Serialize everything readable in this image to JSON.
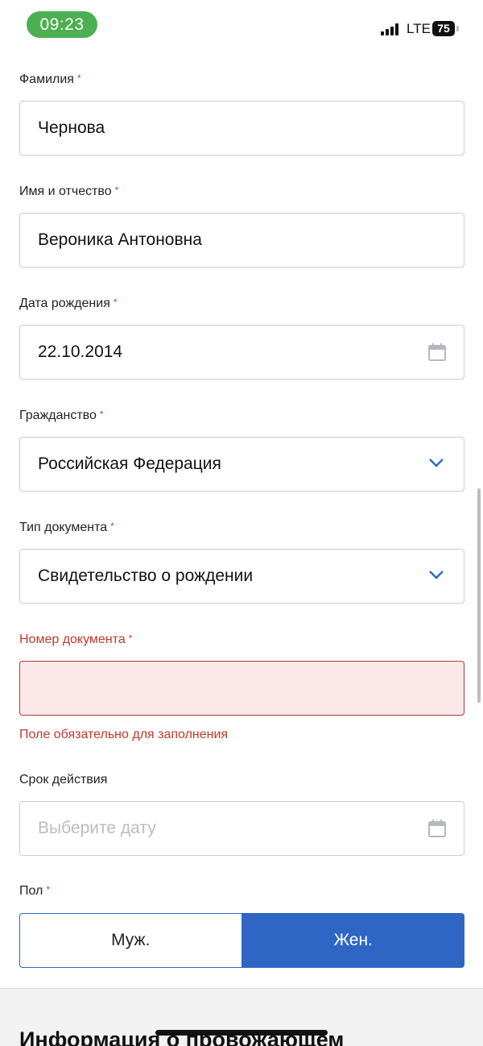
{
  "status_bar": {
    "time": "09:23",
    "network": "LTE",
    "battery": "75"
  },
  "form": {
    "surname": {
      "label": "Фамилия",
      "required_mark": "*",
      "value": "Чернова"
    },
    "name": {
      "label": "Имя и отчество",
      "required_mark": "*",
      "value": "Вероника Антоновна"
    },
    "birth_date": {
      "label": "Дата рождения",
      "required_mark": "*",
      "value": "22.10.2014",
      "icon": "calendar-icon"
    },
    "citizenship": {
      "label": "Гражданство",
      "required_mark": "*",
      "value": "Российская Федерация",
      "icon": "chevron-down-icon"
    },
    "doc_type": {
      "label": "Тип документа",
      "required_mark": "*",
      "value": "Свидетельство о рождении",
      "icon": "chevron-down-icon"
    },
    "doc_number": {
      "label": "Номер документа",
      "required_mark": "*",
      "value": "",
      "error": "Поле обязательно для заполнения"
    },
    "validity": {
      "label": "Срок действия",
      "placeholder": "Выберите дату",
      "icon": "calendar-icon"
    },
    "gender": {
      "label": "Пол",
      "required_mark": "*",
      "options": [
        "Муж.",
        "Жен."
      ],
      "selected": "Жен."
    }
  },
  "section": {
    "title": "Информация о провожающем"
  },
  "colors": {
    "accent": "#2f66c4",
    "error": "#c0392b",
    "error_bg": "#fce8e8",
    "time_pill": "#4caf50"
  }
}
